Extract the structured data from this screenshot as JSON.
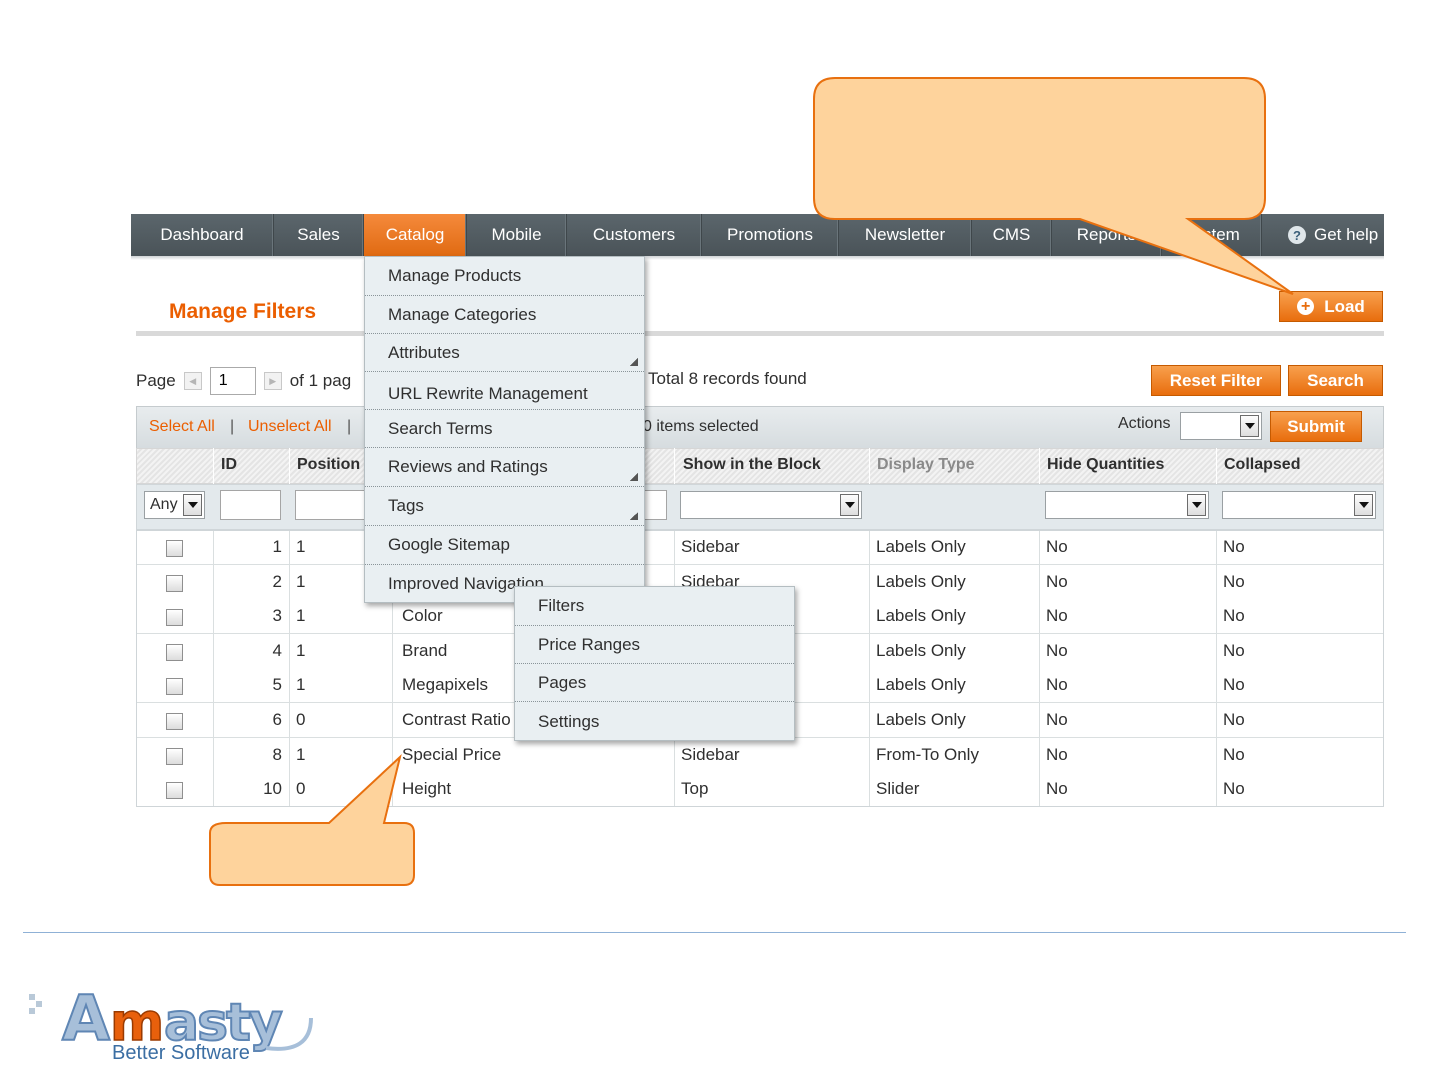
{
  "nav": {
    "items": [
      "Dashboard",
      "Sales",
      "Catalog",
      "Mobile",
      "Customers",
      "Promotions",
      "Newsletter",
      "CMS",
      "Reports",
      "System"
    ],
    "active": "Catalog",
    "help": "Get help"
  },
  "header": {
    "title": "Manage Filters",
    "load_button": "Load"
  },
  "pager": {
    "page_label": "Page",
    "page_value": "1",
    "of_pages": "of 1 pag",
    "records": "Total 8 records found"
  },
  "buttons": {
    "reset_filter": "Reset Filter",
    "search": "Search",
    "submit": "Submit"
  },
  "massaction": {
    "select_all": "Select All",
    "unselect_all": "Unselect All",
    "separator": "|",
    "items_selected": "0 items selected",
    "actions_label": "Actions"
  },
  "grid": {
    "columns": [
      "ID",
      "Position",
      "Show in the Block",
      "Display Type",
      "Hide Quantities",
      "Collapsed"
    ],
    "filter_any": "Any",
    "rows": [
      {
        "id": "1",
        "position": "1",
        "name": "",
        "block": "Sidebar",
        "display": "Labels Only",
        "hide": "No",
        "collapsed": "No"
      },
      {
        "id": "2",
        "position": "1",
        "name": "",
        "block": "Sidebar",
        "display": "Labels Only",
        "hide": "No",
        "collapsed": "No"
      },
      {
        "id": "3",
        "position": "1",
        "name": "Color",
        "block": "",
        "display": "Labels Only",
        "hide": "No",
        "collapsed": "No"
      },
      {
        "id": "4",
        "position": "1",
        "name": "Brand",
        "block": "",
        "display": "Labels Only",
        "hide": "No",
        "collapsed": "No"
      },
      {
        "id": "5",
        "position": "1",
        "name": "Megapixels",
        "block": "",
        "display": "Labels Only",
        "hide": "No",
        "collapsed": "No"
      },
      {
        "id": "6",
        "position": "0",
        "name": "Contrast Ratio",
        "block": "",
        "display": "Labels Only",
        "hide": "No",
        "collapsed": "No"
      },
      {
        "id": "8",
        "position": "1",
        "name": "Special Price",
        "block": "Sidebar",
        "display": "From-To Only",
        "hide": "No",
        "collapsed": "No"
      },
      {
        "id": "10",
        "position": "0",
        "name": "Height",
        "block": "Top",
        "display": "Slider",
        "hide": "No",
        "collapsed": "No"
      }
    ]
  },
  "catalog_menu": {
    "items": [
      "Manage Products",
      "Manage Categories",
      "Attributes",
      "URL Rewrite Management",
      "Search Terms",
      "Reviews and Ratings",
      "Tags",
      "Google Sitemap",
      "Improved Navigation"
    ]
  },
  "submenu": {
    "items": [
      "Filters",
      "Price Ranges",
      "Pages",
      "Settings"
    ]
  },
  "logo": {
    "tagline": "Better Software"
  },
  "colors": {
    "accent": "#eb5e00",
    "nav_bg": "#525c62",
    "callout_fill": "#fed39c",
    "callout_stroke": "#e8700f"
  }
}
